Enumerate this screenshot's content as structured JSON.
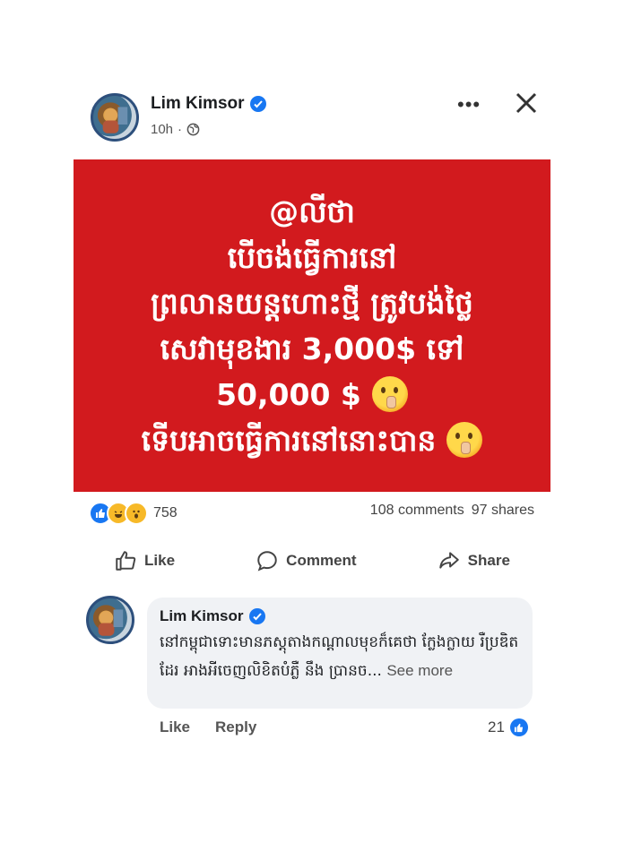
{
  "post": {
    "author": "Lim Kimsor",
    "time": "10h",
    "privacy_icon": "globe-icon",
    "banner_lines": [
      "@លីថា",
      "បើចង់ធ្វើការនៅ",
      "ព្រលានយន្តហោះថ្មី ត្រូវបង់ថ្លៃ",
      "សេវាមុខងារ 3,000$ ទៅ",
      "50,000 $",
      "ទើបអាចធ្វើការនៅនោះបាន"
    ],
    "banner_color": "#d21a1e",
    "reaction_count": "758",
    "comments": "108 comments",
    "shares": "97 shares"
  },
  "actions": {
    "like": "Like",
    "comment": "Comment",
    "share": "Share"
  },
  "comment": {
    "author": "Lim Kimsor",
    "text": "នៅកម្ពុជាទោះមានភស្តុតាងកណ្ដាលមុខក៏គេថា ក្លែងក្លាយ រឺប្រឌិតដែរ អាងអីចេញលិខិតបំភ្លឺ នឹង ប្រានច...",
    "see_more": "See more",
    "like": "Like",
    "reply": "Reply",
    "like_count": "21"
  }
}
